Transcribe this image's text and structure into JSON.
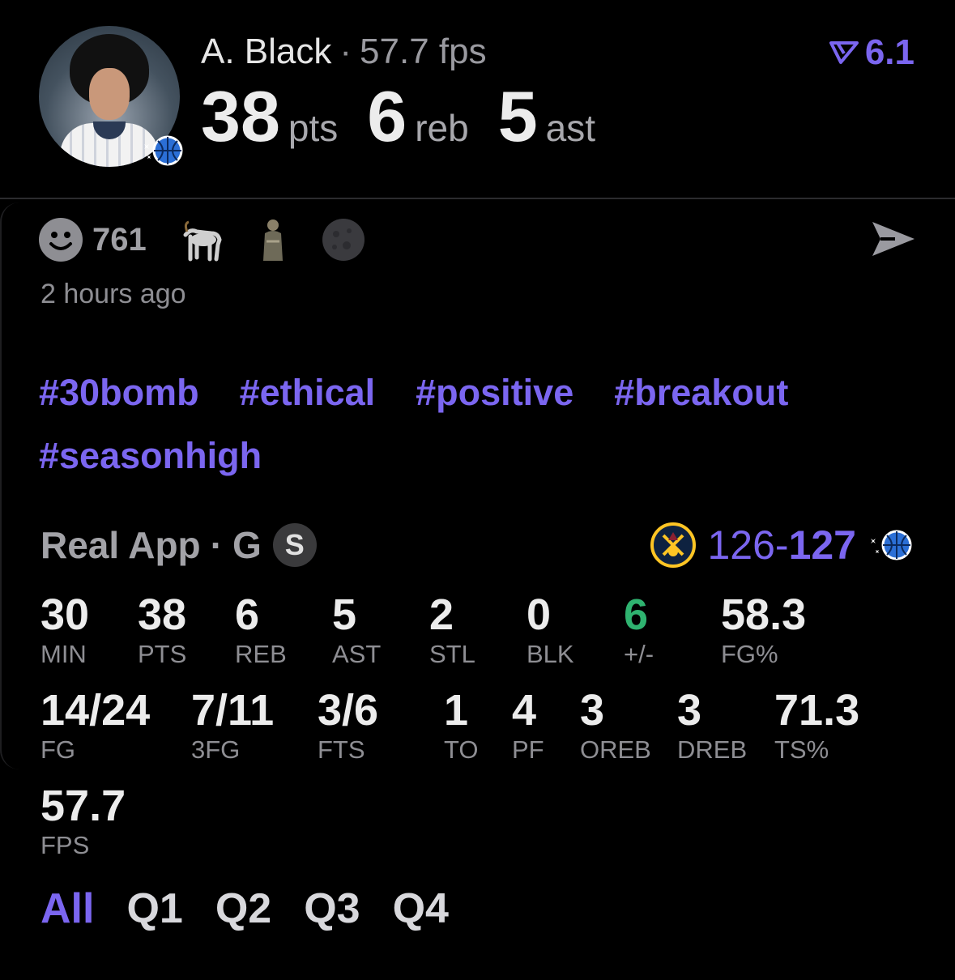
{
  "player": {
    "name": "A. Black",
    "fps_text": "57.7 fps",
    "pts": "38",
    "pts_label": "pts",
    "reb": "6",
    "reb_label": "reb",
    "ast": "5",
    "ast_label": "ast",
    "rating": "6.1"
  },
  "reactions": {
    "count": "761",
    "icons": [
      "smiley-icon",
      "goat-icon",
      "figurine-icon",
      "moon-icon"
    ]
  },
  "time": "2 hours ago",
  "tags": [
    "#30bomb",
    "#ethical",
    "#positive",
    "#breakout",
    "#seasonhigh"
  ],
  "source": {
    "app": "Real App",
    "sep": "·",
    "game": "G",
    "badge": "S"
  },
  "score": {
    "away": "126",
    "dash": "-",
    "home": "127"
  },
  "stats": [
    {
      "value": "30",
      "label": "MIN"
    },
    {
      "value": "38",
      "label": "PTS"
    },
    {
      "value": "6",
      "label": "REB"
    },
    {
      "value": "5",
      "label": "AST"
    },
    {
      "value": "2",
      "label": "STL"
    },
    {
      "value": "0",
      "label": "BLK"
    },
    {
      "value": "6",
      "label": "+/-"
    },
    {
      "value": "58.3",
      "label": "FG%"
    },
    {
      "value": "14/24",
      "label": "FG"
    },
    {
      "value": "7/11",
      "label": "3FG"
    },
    {
      "value": "3/6",
      "label": "FTS"
    },
    {
      "value": "1",
      "label": "TO"
    },
    {
      "value": "4",
      "label": "PF"
    },
    {
      "value": "3",
      "label": "OREB"
    },
    {
      "value": "3",
      "label": "DREB"
    },
    {
      "value": "71.3",
      "label": "TS%"
    },
    {
      "value": "57.7",
      "label": "FPS"
    }
  ],
  "quarters": [
    "All",
    "Q1",
    "Q2",
    "Q3",
    "Q4"
  ],
  "colors": {
    "accent": "#7b66f0",
    "positive": "#2fb370",
    "muted": "#8e8e93"
  }
}
